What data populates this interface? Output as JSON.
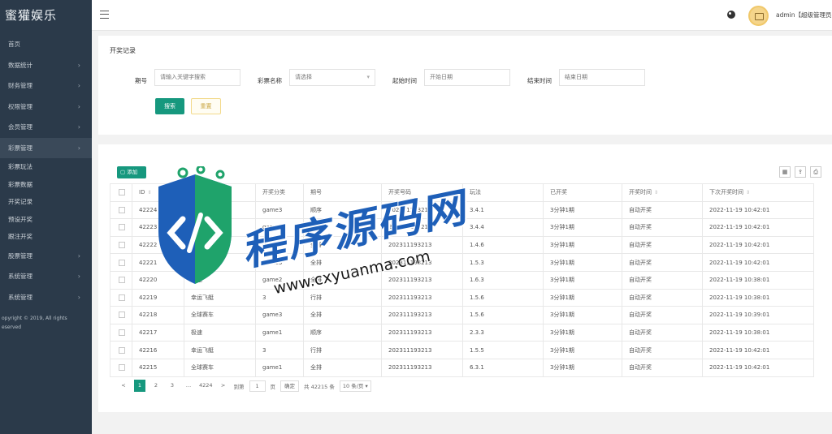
{
  "app": {
    "brand": "蜜獾娱乐"
  },
  "sidebar": {
    "items": [
      {
        "label": "首页",
        "has_arrow": false
      },
      {
        "label": "数据统计",
        "has_arrow": true
      },
      {
        "label": "财务管理",
        "has_arrow": true
      },
      {
        "label": "权限管理",
        "has_arrow": true
      },
      {
        "label": "会员管理",
        "has_arrow": true
      },
      {
        "label": "彩票管理",
        "has_arrow": true,
        "active": true
      }
    ],
    "sub_items": [
      "彩票玩法",
      "彩票数据",
      "开奖记录",
      "预设开奖",
      "跟注开奖"
    ],
    "items_after": [
      {
        "label": "股票管理",
        "has_arrow": true
      },
      {
        "label": "系统管理",
        "has_arrow": true
      },
      {
        "label": "系统管理",
        "has_arrow": true
      }
    ],
    "copyright_line1": "opyright © 2019, All rights",
    "copyright_line2": "eserved"
  },
  "topbar": {
    "user": "admin【超级管理员】"
  },
  "search": {
    "title": "开奖记录",
    "fields": [
      {
        "label": "期号",
        "placeholder": "请输入关键字搜索"
      },
      {
        "label": "彩票名称",
        "placeholder": "请选择"
      },
      {
        "label": "起始时间",
        "placeholder": "开始日期"
      },
      {
        "label": "结束时间",
        "placeholder": "结束日期"
      }
    ],
    "search_button": "搜索",
    "reset_button": "重置"
  },
  "table": {
    "add_button": "添加",
    "tool_icons": [
      "columns-icon",
      "export-icon",
      "print-icon"
    ],
    "columns": [
      "ID",
      "彩种名称",
      "开奖分类",
      "开奖分类",
      "期号",
      "开奖号码",
      "玩法",
      "是否开奖",
      "开奖时间",
      "下次开奖时间"
    ],
    "header_labels": {
      "id": "ID",
      "name": "彩种名称",
      "type": "开奖分类",
      "issue": "期号",
      "number": "开奖号码",
      "rate": "玩法",
      "open": "已开奖",
      "time": "开奖时间",
      "next_time": "下次开奖时间"
    },
    "rows": [
      {
        "id": "42224",
        "name": "幸运飞艇",
        "game": "game3",
        "type": "顺序",
        "issue": "202311193213",
        "number": "3.4.1",
        "rate": "3分钟1期",
        "open": "自动开奖",
        "time": "2022-11-19 10:42:01",
        "next": "2022-11-19 10:42:01"
      },
      {
        "id": "42223",
        "name": "幸运飞艇",
        "game": "game3",
        "type": "顺序",
        "issue": "202311193213",
        "number": "3.4.4",
        "rate": "3分钟1期",
        "open": "自动开奖",
        "time": "2022-11-19 10:42:01",
        "next": "2022-11-19 10:42:01"
      },
      {
        "id": "42222",
        "name": "幸运飞艇",
        "game": "game3",
        "type": "全排",
        "issue": "202311193213",
        "number": "1.4.6",
        "rate": "3分钟1期",
        "open": "自动开奖",
        "time": "2022-11-19 10:42:01",
        "next": "2022-11-19 10:42:01"
      },
      {
        "id": "42221",
        "name": "极速赛车",
        "game": "game3",
        "type": "全排",
        "issue": "202311193213",
        "number": "1.5.3",
        "rate": "3分钟1期",
        "open": "自动开奖",
        "time": "2022-11-19 10:42:01",
        "next": "2022-11-19 10:42:01"
      },
      {
        "id": "42220",
        "name": "极速",
        "game": "game2",
        "type": "全排",
        "issue": "202311193213",
        "number": "1.6.3",
        "rate": "3分钟1期",
        "open": "自动开奖",
        "time": "2022-11-19 10:38:01",
        "next": "2022-11-19 10:38:01"
      },
      {
        "id": "42219",
        "name": "幸运飞艇",
        "game": "3",
        "type": "行排",
        "issue": "202311193213",
        "number": "1.5.6",
        "rate": "3分钟1期",
        "open": "自动开奖",
        "time": "2022-11-19 10:38:01",
        "next": "2022-11-19 10:38:01"
      },
      {
        "id": "42218",
        "name": "全球赛车",
        "game": "game3",
        "type": "全排",
        "issue": "202311193213",
        "number": "1.5.6",
        "rate": "3分钟1期",
        "open": "自动开奖",
        "time": "2022-11-19 10:39:01",
        "next": "2022-11-19 10:42:01"
      },
      {
        "id": "42217",
        "name": "极速",
        "game": "game1",
        "type": "顺序",
        "issue": "202311193213",
        "number": "2.3.3",
        "rate": "3分钟1期",
        "open": "自动开奖",
        "time": "2022-11-19 10:38:01",
        "next": "2022-11-19 10:38:01"
      },
      {
        "id": "42216",
        "name": "幸运飞艇",
        "game": "3",
        "type": "行排",
        "issue": "202311193213",
        "number": "1.5.5",
        "rate": "3分钟1期",
        "open": "自动开奖",
        "time": "2022-11-19 10:42:01",
        "next": "2022-11-19 10:42:01"
      },
      {
        "id": "42215",
        "name": "全球赛车",
        "game": "game1",
        "type": "全排",
        "issue": "202311193213",
        "number": "6.3.1",
        "rate": "3分钟1期",
        "open": "自动开奖",
        "time": "2022-11-19 10:42:01",
        "next": "2022-11-19 10:42:01"
      }
    ]
  },
  "pager": {
    "prev": "<",
    "pages": [
      "1",
      "2",
      "3",
      "…",
      "4224"
    ],
    "current": "1",
    "next": ">",
    "goto_label": "到第",
    "goto_value": "1",
    "goto_unit": "页",
    "confirm": "确定",
    "total": "共 42215 条",
    "page_size": "10 条/页"
  },
  "watermark": {
    "title": "程序源码网",
    "url": "www.cxyuanma.com"
  }
}
